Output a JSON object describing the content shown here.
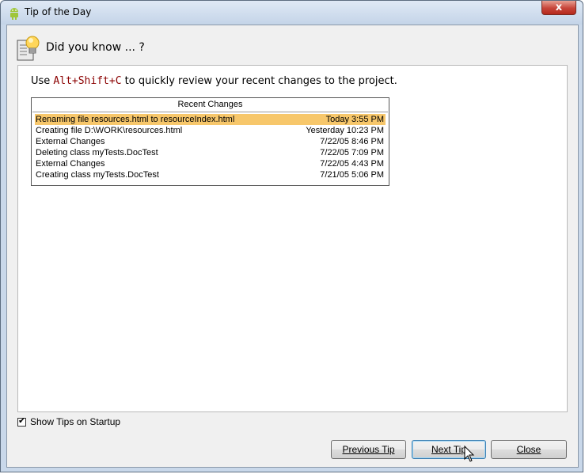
{
  "window": {
    "title": "Tip of the Day",
    "app_icon": "android-icon",
    "close_glyph": "x"
  },
  "header": {
    "text": "Did you know ... ?",
    "icon": "lightbulb-icon"
  },
  "tip": {
    "prefix": "Use ",
    "shortcut": "Alt+Shift+C",
    "suffix": " to quickly review your recent changes to the project."
  },
  "recent_changes": {
    "title": "Recent Changes",
    "rows": [
      {
        "name": "Renaming file resources.html to resourceIndex.html",
        "time": "Today 3:55 PM"
      },
      {
        "name": "Creating file D:\\WORK\\resources.html",
        "time": "Yesterday 10:23 PM"
      },
      {
        "name": "External Changes",
        "time": "7/22/05 8:46 PM"
      },
      {
        "name": "Deleting class myTests.DocTest",
        "time": "7/22/05 7:09 PM"
      },
      {
        "name": "External Changes",
        "time": "7/22/05 4:43 PM"
      },
      {
        "name": "Creating class myTests.DocTest",
        "time": "7/21/05 5:06 PM"
      }
    ],
    "selected_color": "#f7c76b"
  },
  "startup": {
    "label": "Show Tips on Startup",
    "checked": true
  },
  "buttons": {
    "previous": "Previous Tip",
    "next": "Next Tip",
    "close": "Close"
  }
}
